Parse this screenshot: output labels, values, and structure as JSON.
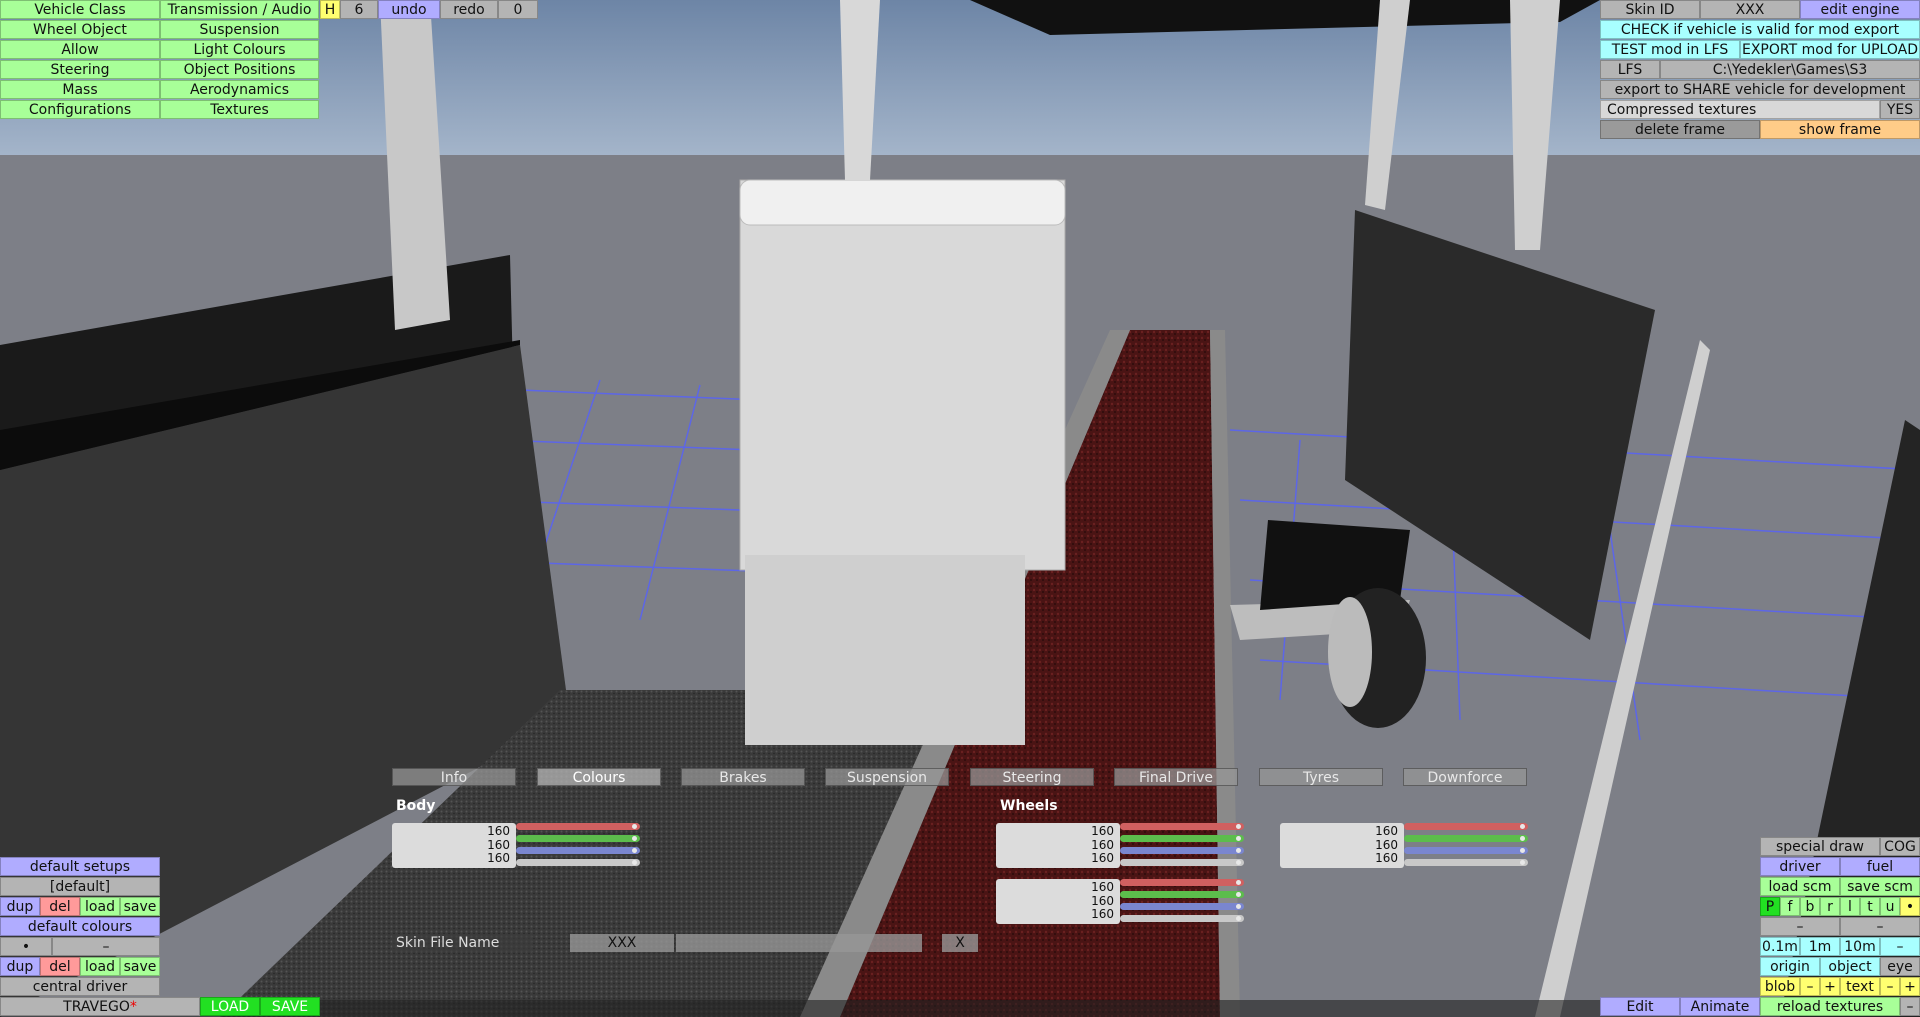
{
  "top_left_menu": {
    "col1": [
      "Vehicle Class",
      "Wheel Object",
      "Allow",
      "Steering",
      "Mass",
      "Configurations"
    ],
    "col2": [
      "Transmission / Audio",
      "Suspension",
      "Light Colours",
      "Object Positions",
      "Aerodynamics",
      "Textures"
    ]
  },
  "history": {
    "h": "H",
    "count": "6",
    "undo": "undo",
    "redo": "redo",
    "redo_count": "0"
  },
  "top_right": {
    "skin_id_label": "Skin ID",
    "skin_id_value": "XXX",
    "edit_engine": "edit engine",
    "check_valid": "CHECK if vehicle is valid for mod export",
    "test_mod": "TEST mod in LFS",
    "export_upload": "EXPORT mod for UPLOAD",
    "lfs_label": "LFS",
    "lfs_path": "C:\\Yedekler\\Games\\S3",
    "export_share": "export to SHARE vehicle for development",
    "compressed_label": "Compressed textures",
    "compressed_value": "YES",
    "delete_frame": "delete frame",
    "show_frame": "show frame"
  },
  "tabs": [
    {
      "label": "Info",
      "active": false
    },
    {
      "label": "Colours",
      "active": true
    },
    {
      "label": "Brakes",
      "active": false
    },
    {
      "label": "Suspension",
      "active": false
    },
    {
      "label": "Steering",
      "active": false
    },
    {
      "label": "Final Drive",
      "active": false
    },
    {
      "label": "Tyres",
      "active": false
    },
    {
      "label": "Downforce",
      "active": false
    }
  ],
  "colours": {
    "body_title": "Body",
    "wheels_title": "Wheels",
    "body": [
      "160",
      "160",
      "160"
    ],
    "wheels_a": [
      "160",
      "160",
      "160"
    ],
    "wheels_b": [
      "160",
      "160",
      "160"
    ],
    "extra": [
      "160",
      "160",
      "160"
    ]
  },
  "skin_file": {
    "label": "Skin File Name",
    "value": "XXX",
    "clear": "X"
  },
  "bottom_left": {
    "default_setups": "default setups",
    "setup_value": "[default]",
    "dup": "dup",
    "del": "del",
    "load": "load",
    "save": "save",
    "default_colours": "default colours",
    "dot": "•",
    "dash": "–",
    "central_driver": "central driver",
    "vehicle_name": "TRAVEGO",
    "modified_mark": "*",
    "load_big": "LOAD",
    "save_big": "SAVE"
  },
  "bottom_right": {
    "special_draw": "special draw",
    "cog": "COG",
    "driver": "driver",
    "fuel": "fuel",
    "load_scm": "load scm",
    "save_scm": "save scm",
    "view_letters": [
      "P",
      "f",
      "b",
      "r",
      "l",
      "t",
      "u",
      "•"
    ],
    "minus_a": "–",
    "minus_b": "–",
    "steps": [
      "0.1m",
      "1m",
      "10m",
      "–"
    ],
    "origin": "origin",
    "object": "object",
    "eye": "eye",
    "blob": "blob",
    "blob_minus": "–",
    "blob_plus": "+",
    "text": "text",
    "text_minus": "–",
    "text_plus": "+",
    "edit": "Edit",
    "animate": "Animate",
    "reload_textures": "reload textures",
    "end_minus": "–"
  },
  "colors": {
    "menu_green": "#a8ff98",
    "accent_blue": "#b0acff",
    "accent_cyan": "#a8ffff",
    "accent_yellow": "#ffff70"
  }
}
